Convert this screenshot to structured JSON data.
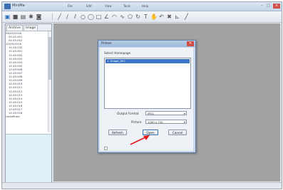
{
  "window": {
    "title": "MiniMe",
    "menu": [
      "File",
      "Edit",
      "View",
      "Tools",
      "Help"
    ]
  },
  "left_panel": {
    "tabs": [
      "Archive",
      "Image"
    ],
    "tree": [
      "06/05/2016",
      "04.05.001",
      "04.05.002",
      "10/29/2018",
      "10.28.235",
      "10.49.001",
      "10.49.002",
      "10.49.003",
      "10.49.004",
      "10.49.005",
      "10.49.006",
      "10.49.007",
      "10.49.008",
      "10.49.009",
      "10.49.010",
      "10.49.011",
      "10.49.012",
      "10.49.013",
      "10.49.014",
      "10.49.015",
      "10.49.016",
      "10.49.017",
      "10.49.018",
      "Undefined"
    ]
  },
  "dialog": {
    "title": "Primer",
    "select_label": "Select Homepage",
    "list_item": "1. Image_001",
    "format_label": "Output Format",
    "format_value": "JPEG",
    "size_label": "Picture",
    "size_value": "1280 x 720",
    "buttons": {
      "refresh": "Refresh",
      "open": "Open",
      "cancel": "Cancel"
    }
  },
  "accent": "#3c74c8"
}
